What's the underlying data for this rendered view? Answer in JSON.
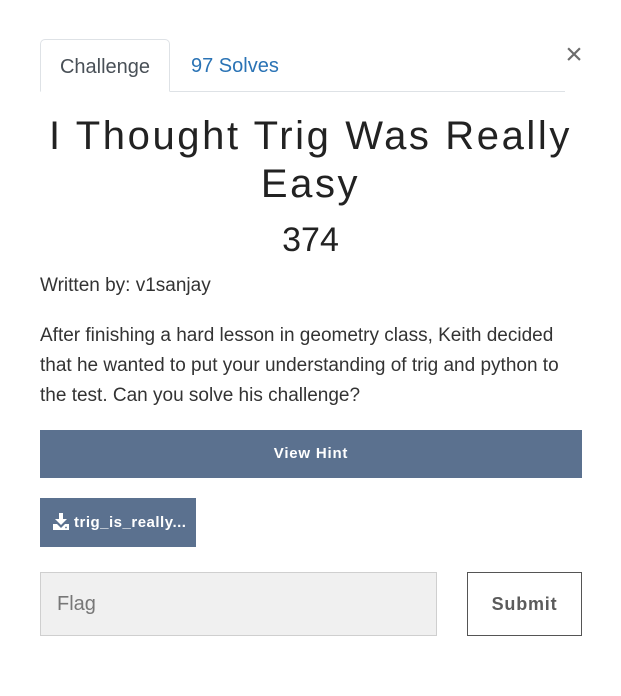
{
  "tabs": {
    "challenge_label": "Challenge",
    "solves_label": "97 Solves"
  },
  "close_symbol": "×",
  "challenge": {
    "title": "I Thought Trig Was Really Easy",
    "points": "374",
    "author": "Written by: v1sanjay",
    "description": "After finishing a hard lesson in geometry class, Keith decided that he wanted to put your understanding of trig and python to the test. Can you solve his challenge?"
  },
  "hint": {
    "label": "View Hint"
  },
  "file": {
    "icon": "download-icon",
    "label": "trig_is_really..."
  },
  "form": {
    "flag_placeholder": "Flag",
    "submit_label": "Submit"
  },
  "colors": {
    "button_bg": "#5b718f",
    "link": "#2a73b5",
    "input_bg": "#f0f0f0"
  }
}
